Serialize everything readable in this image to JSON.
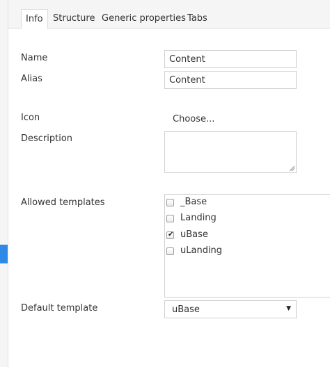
{
  "tabs": [
    {
      "label": "Info",
      "active": true
    },
    {
      "label": "Structure"
    },
    {
      "label": "Generic properties"
    },
    {
      "label": "Tabs"
    }
  ],
  "form": {
    "name_label": "Name",
    "name_value": "Content",
    "alias_label": "Alias",
    "alias_value": "Content",
    "icon_label": "Icon",
    "icon_choose": "Choose...",
    "description_label": "Description",
    "description_value": "",
    "allowed_templates_label": "Allowed templates",
    "templates": [
      {
        "label": "_Base",
        "checked": false
      },
      {
        "label": "Landing",
        "checked": false
      },
      {
        "label": "uBase",
        "checked": true
      },
      {
        "label": "uLanding",
        "checked": false
      }
    ],
    "default_template_label": "Default template",
    "default_template_value": "uBase"
  },
  "colors": {
    "accent": "#2e8ae6",
    "border": "#cfcfcf",
    "tab_bar": "#f5f5f5"
  }
}
